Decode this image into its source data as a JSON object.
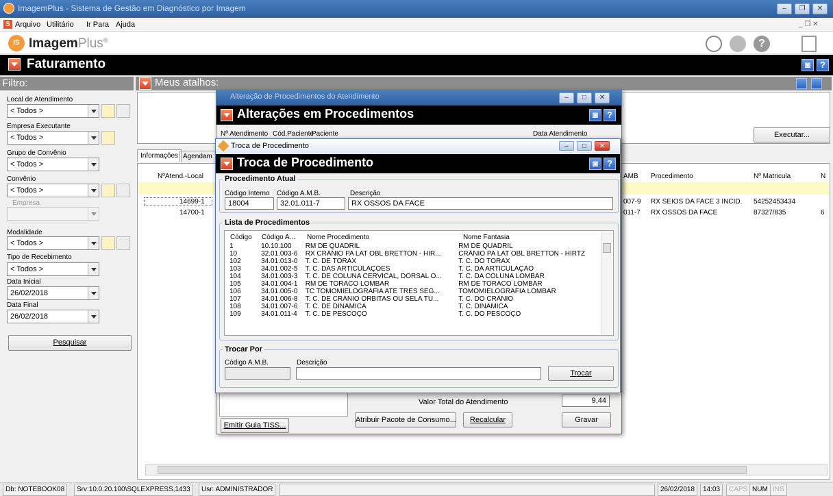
{
  "window": {
    "title": "ImagemPlus - Sistema de Gestão em Diagnóstico por Imagem"
  },
  "menu": {
    "items": [
      "Arquivo",
      "Utilitário",
      "Ir Para",
      "Ajuda"
    ]
  },
  "app": {
    "logo_name": "Imagem",
    "logo_suffix": "Plus",
    "logo_reg": "®",
    "module_title": "Faturamento"
  },
  "filter": {
    "header": "Filtro:",
    "local_label": "Local de Atendimento",
    "local_value": "< Todos >",
    "empresa_exec_label": "Empresa Executante",
    "empresa_exec_value": "< Todos >",
    "grupo_label": "Grupo de Convênio",
    "grupo_value": "< Todos >",
    "convenio_label": "Convênio",
    "convenio_value": "< Todos >",
    "empresa_label": "Empresa",
    "empresa_value": "",
    "modalidade_label": "Modalidade",
    "modalidade_value": "< Todos >",
    "tipo_label": "Tipo de Recebimento",
    "tipo_value": "< Todos >",
    "data_inicial_label": "Data Inicial",
    "data_inicial_value": "26/02/2018",
    "data_final_label": "Data Final",
    "data_final_value": "26/02/2018",
    "search_button": "Pesquisar"
  },
  "shortcuts": {
    "header": "Meus atalhos:",
    "execute_button": "Executar..."
  },
  "tabs": [
    "Informações",
    "Agendam"
  ],
  "grid": {
    "headers": [
      "NºAtend.-Local",
      "AMB",
      "Procedimento",
      "Nº Matricula",
      "N"
    ],
    "rows": [
      {
        "atend": "14699-1",
        "amb": "007-9",
        "proc": "RX SEIOS DA FACE 3 INCID.",
        "matricula": "54252453434",
        "n": ""
      },
      {
        "atend": "14700-1",
        "amb": "011-7",
        "proc": "RX OSSOS DA FACE",
        "matricula": "87327/835",
        "n": "6"
      }
    ]
  },
  "alteracoes": {
    "title": "Alteração de Procedimentos do Atendimento",
    "header": "Alterações em Procedimentos",
    "cols": [
      "Nº Atendimento",
      "Cód.Paciente",
      "Paciente",
      "Data Atendimento"
    ],
    "valor_label": "Valor Total do Atendimento",
    "valor": "9,44",
    "emitir_button": "Emitir Guia TISS...",
    "atribuir_button": "Atribuir Pacote de Consumo...",
    "recalcular_button": "Recalcular",
    "gravar_button": "Gravar"
  },
  "troca": {
    "window_title": "Troca de Procedimento",
    "header": "Troca de Procedimento",
    "atual_legend": "Procedimento Atual",
    "cod_interno_label": "Código Interno",
    "cod_amb_label": "Código A.M.B.",
    "descricao_label": "Descrição",
    "cod_interno": "18004",
    "cod_amb": "32.01.011-7",
    "descricao": "RX OSSOS DA FACE",
    "lista_legend": "Lista de Procedimentos",
    "list_headers": [
      "Código",
      "Código A...",
      "Nome Procedimento",
      "Nome Fantasia"
    ],
    "list_rows": [
      [
        "1",
        "10.10.100",
        "RM DE QUADRIL",
        "RM DE QUADRIL"
      ],
      [
        "10",
        "32.01.003-6",
        "RX CRÂNIO PA LAT OBL BRETTON - HIR...",
        "CRÂNIO PA LAT OBL BRETTON - HIRTZ"
      ],
      [
        "102",
        "34.01.013-0",
        "T. C. DE TÓRAX",
        "T. C. DO TÓRAX"
      ],
      [
        "103",
        "34.01.002-5",
        "T. C. DAS ARTICULAÇÕES",
        "T. C. DA ARTICULAÇÃO"
      ],
      [
        "104",
        "34.01.003-3",
        "T. C. DE COLUNA CERVICAL, DORSAL O...",
        "T. C. DA COLUNA LOMBAR"
      ],
      [
        "105",
        "34.01.004-1",
        "RM DE TORACO LOMBAR",
        "RM DE TORACO LOMBAR"
      ],
      [
        "106",
        "34.01.005-0",
        "TC TOMOMIELOGRAFIA ATÉ TRÊS SEG...",
        "TOMOMIELOGRAFIA LOMBAR"
      ],
      [
        "107",
        "34.01.006-8",
        "T. C. DE CRÂNIO ÓRBITAS OU SELA TÚ...",
        "T. C. DO CRÂNIO"
      ],
      [
        "108",
        "34.01.007-6",
        "T. C. DE DINÂMICA",
        "T. C. DINÂMICA"
      ],
      [
        "109",
        "34.01.011-4",
        "T. C. DE PESCOÇO",
        "T. C. DO PESCOÇO"
      ]
    ],
    "trocar_legend": "Trocar Por",
    "trocar_cod_label": "Código A.M.B.",
    "trocar_desc_label": "Descrição",
    "trocar_button": "Trocar"
  },
  "status": {
    "db": "Db: NOTEBOOK08",
    "srv": "Srv:10.0.20.100\\SQLEXPRESS,1433",
    "usr": "Usr: ADMINISTRADOR",
    "date": "26/02/2018",
    "time": "14:03",
    "caps": "CAPS",
    "num": "NUM",
    "ins": "INS"
  },
  "colors": {
    "accent": "#2c5fa0",
    "brand_orange": "#f39a3b",
    "header_gray": "#8c8c8c",
    "selected_row": "#fff9c4"
  }
}
